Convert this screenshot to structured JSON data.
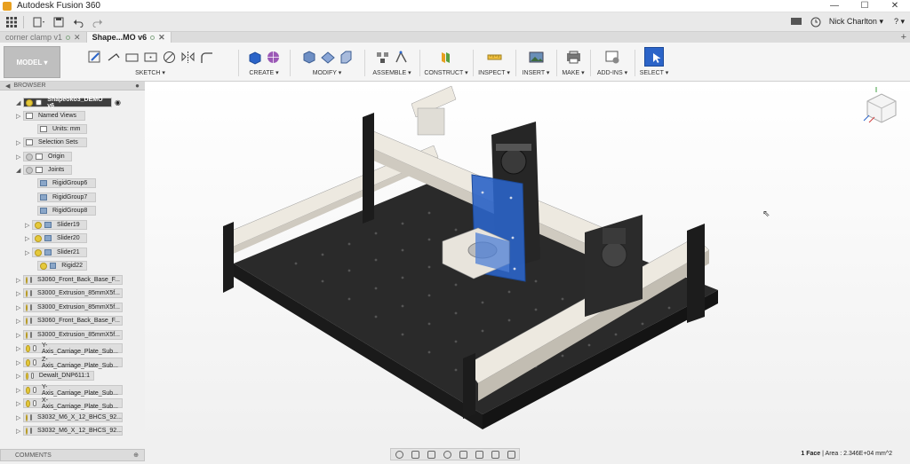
{
  "app": {
    "title": "Autodesk Fusion 360"
  },
  "window_controls": {
    "minimize": "—",
    "maximize": "☐",
    "close": "✕"
  },
  "quick_access": {
    "user_name": "Nick Charlton ▾",
    "help": "? ▾"
  },
  "tabs": [
    {
      "label": "corner clamp v1",
      "active": false
    },
    {
      "label": "Shape...MO v6",
      "active": true
    }
  ],
  "toolbar": {
    "workspace": "MODEL ▾",
    "groups": [
      {
        "label": "SKETCH ▾"
      },
      {
        "label": "CREATE ▾"
      },
      {
        "label": "MODIFY ▾"
      },
      {
        "label": "ASSEMBLE ▾"
      },
      {
        "label": "CONSTRUCT ▾"
      },
      {
        "label": "INSPECT ▾"
      },
      {
        "label": "INSERT ▾"
      },
      {
        "label": "MAKE ▾"
      },
      {
        "label": "ADD-INS ▾"
      },
      {
        "label": "SELECT ▾"
      }
    ]
  },
  "browser": {
    "header": "BROWSER",
    "items": [
      {
        "label": "Shapeoko3_DEMO v6"
      },
      {
        "label": "Named Views"
      },
      {
        "label": "Units: mm"
      },
      {
        "label": "Selection Sets"
      },
      {
        "label": "Origin"
      },
      {
        "label": "Joints"
      },
      {
        "label": "RigidGroup6"
      },
      {
        "label": "RigidGroup7"
      },
      {
        "label": "RigidGroup8"
      },
      {
        "label": "Slider19"
      },
      {
        "label": "Slider20"
      },
      {
        "label": "Slider21"
      },
      {
        "label": "Rigid22"
      },
      {
        "label": "S3060_Front_Back_Base_F..."
      },
      {
        "label": "S3000_Extrusion_85mmX5f..."
      },
      {
        "label": "S3000_Extrusion_85mmX5f..."
      },
      {
        "label": "S3060_Front_Back_Base_F..."
      },
      {
        "label": "S3000_Extrusion_85mmX5f..."
      },
      {
        "label": "Y-Axis_Carriage_Plate_Sub..."
      },
      {
        "label": "Z-Axis_Carriage_Plate_Sub..."
      },
      {
        "label": "Dewalt_DNP611:1"
      },
      {
        "label": "Y-Axis_Carriage_Plate_Sub..."
      },
      {
        "label": "X-Axis_Carriage_Plate_Sub..."
      },
      {
        "label": "S3032_M6_X_12_BHCS_92..."
      },
      {
        "label": "S3032_M6_X_12_BHCS_92..."
      }
    ]
  },
  "comments": {
    "label": "COMMENTS"
  },
  "status": {
    "selection": "1 Face",
    "area": " | Area : 2.346E+04 mm^2"
  },
  "colors": {
    "accent_blue": "#2b64c8",
    "rail": "#e8e4dc",
    "frame": "#2a2a2a"
  }
}
